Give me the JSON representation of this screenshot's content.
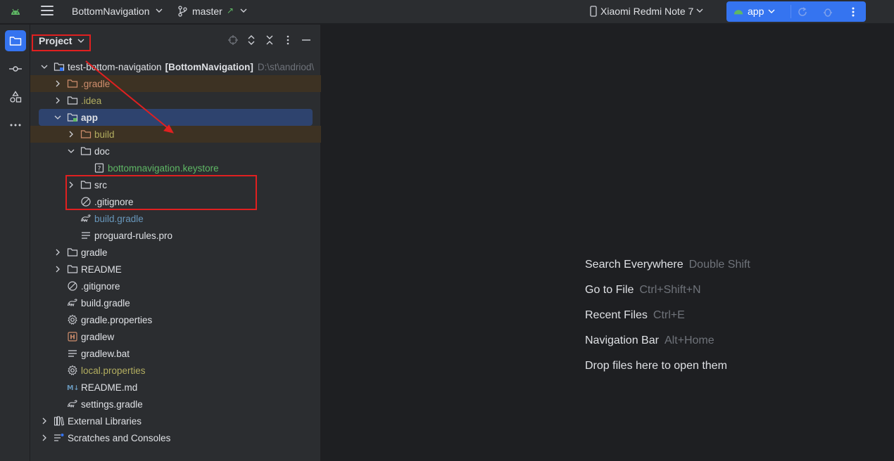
{
  "titlebar": {
    "project_name": "BottomNavigation",
    "branch": "master",
    "branch_arrow": "↗",
    "device": "Xiaomi Redmi Note 7",
    "run_config": "app"
  },
  "panel": {
    "title": "Project",
    "tree": [
      {
        "label": "test-bottom-navigation",
        "suffix": "[BottomNavigation]",
        "path": "D:\\st\\andriod\\"
      },
      {
        "label": ".gradle"
      },
      {
        "label": ".idea"
      },
      {
        "label": "app"
      },
      {
        "label": "build"
      },
      {
        "label": "doc"
      },
      {
        "label": "bottomnavigation.keystore"
      },
      {
        "label": "src"
      },
      {
        "label": ".gitignore"
      },
      {
        "label": "build.gradle"
      },
      {
        "label": "proguard-rules.pro"
      },
      {
        "label": "gradle"
      },
      {
        "label": "README"
      },
      {
        "label": ".gitignore"
      },
      {
        "label": "build.gradle"
      },
      {
        "label": "gradle.properties"
      },
      {
        "label": "gradlew"
      },
      {
        "label": "gradlew.bat"
      },
      {
        "label": "local.properties"
      },
      {
        "label": "README.md"
      },
      {
        "label": "settings.gradle"
      },
      {
        "label": "External Libraries"
      },
      {
        "label": "Scratches and Consoles"
      }
    ]
  },
  "editor": {
    "hints": [
      {
        "action": "Search Everywhere",
        "shortcut": "Double Shift"
      },
      {
        "action": "Go to File",
        "shortcut": "Ctrl+Shift+N"
      },
      {
        "action": "Recent Files",
        "shortcut": "Ctrl+E"
      },
      {
        "action": "Navigation Bar",
        "shortcut": "Alt+Home"
      },
      {
        "action": "Drop files here to open them",
        "shortcut": ""
      }
    ]
  },
  "colors": {
    "accent": "#3574f0",
    "annotation_red": "#e02020",
    "excluded_text": "#cf8e6d",
    "vcs_new_green": "#5fb865",
    "ignored_olive": "#b3ae60",
    "modified_blue": "#6897bb"
  }
}
